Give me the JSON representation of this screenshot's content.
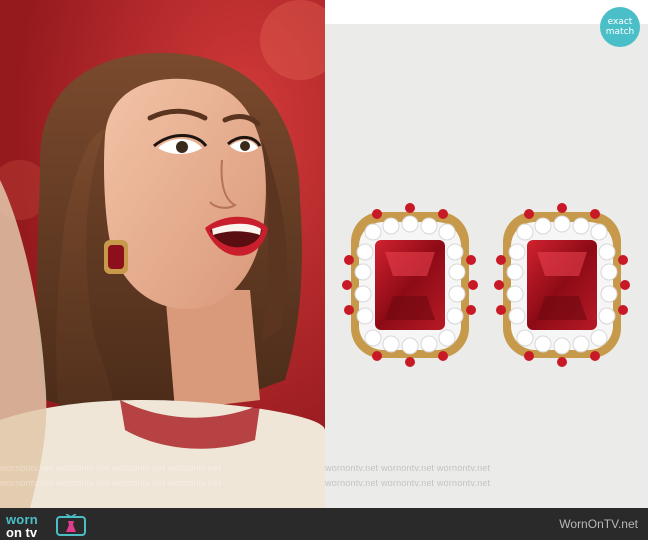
{
  "left_photo": {
    "description_icon": "woman-laughing-photo",
    "colors": {
      "background": "#b01f22",
      "skin": "#eab497",
      "hair": "#6b4128",
      "jacket": "#efe6d8",
      "lip": "#c91f2c"
    }
  },
  "right_panel": {
    "badge": {
      "line1": "exact",
      "line2": "match",
      "color": "#4bbfc8"
    },
    "product_icon": "red-crystal-stud-earrings",
    "colors": {
      "panel": "#ebebea",
      "stone": "#9c0f1a",
      "gold": "#c69a4a",
      "crystal": "#ffffff"
    }
  },
  "watermarks": {
    "left_row1": "wornontv.net   wornontv.net   wornontv.net   wornontv.net",
    "left_row2": "wornontv.net   wornontv.net   wornontv.net   wornontv.net",
    "right_row1": "wornontv.net   wornontv.net   wornontv.net",
    "right_row2": "wornontv.net   wornontv.net   wornontv.net"
  },
  "footer": {
    "logo_worn": "worn",
    "logo_ontv": "on tv",
    "site_name": "WornOnTV.net",
    "colors": {
      "bar": "#2a2a2a",
      "accent": "#4bbfc8",
      "magenta": "#e33c8f"
    }
  }
}
